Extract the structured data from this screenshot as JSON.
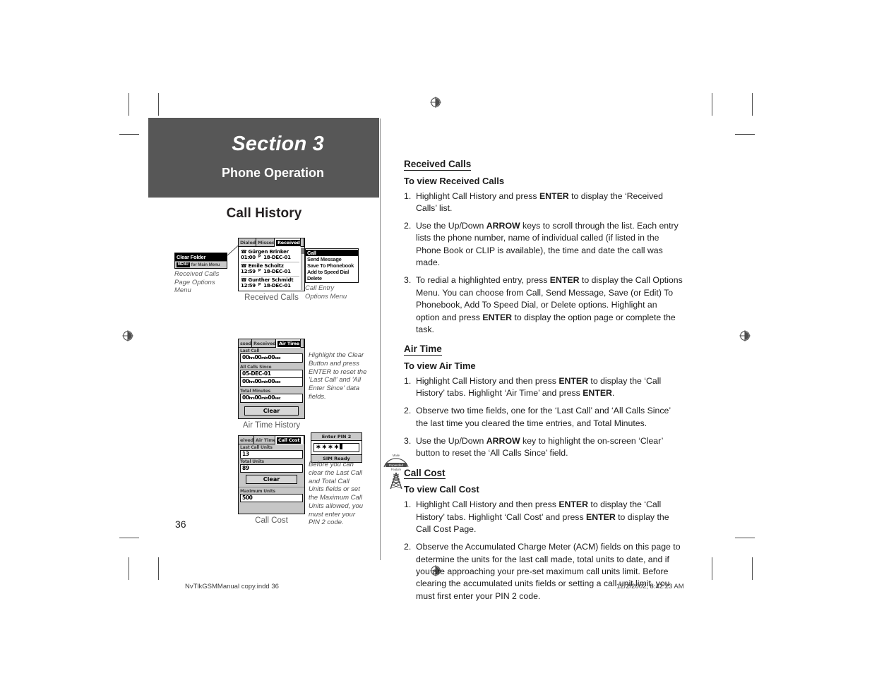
{
  "header": {
    "section": "Section 3",
    "subtitle": "Phone Operation"
  },
  "left_column": {
    "heading": "Call History",
    "received_calls_figure": {
      "caption": "Received Calls",
      "tabs": [
        {
          "label": "Dialed",
          "active": false
        },
        {
          "label": "Missed",
          "active": false
        },
        {
          "label": "Received",
          "active": true
        }
      ],
      "entries": [
        {
          "icon": "phone-icon",
          "name": "Gürgen Brinker",
          "time": "01:00",
          "ampm": "P",
          "date": "18-DEC-01"
        },
        {
          "icon": "phone-icon",
          "name": "Emile Scholtz",
          "time": "12:59",
          "ampm": "P",
          "date": "18-DEC-01"
        },
        {
          "icon": "phone-icon",
          "name": "Gunther Schmidt",
          "time": "12:59",
          "ampm": "P",
          "date": "18-DEC-01"
        }
      ]
    },
    "options_menu": {
      "selected_item": "Clear Folder",
      "footer_key": "MENU",
      "footer_text": "for Main Menu",
      "note": "Received Calls Page Options Menu"
    },
    "call_entry_menu": {
      "items": [
        {
          "label": "Call",
          "selected": true
        },
        {
          "label": "Send Message",
          "selected": false
        },
        {
          "label": "Save To Phonebook",
          "selected": false
        },
        {
          "label": "Add to Speed Dial",
          "selected": false
        },
        {
          "label": "Delete",
          "selected": false
        }
      ],
      "note": "Call Entry Options Menu"
    },
    "air_time_figure": {
      "caption": "Air Time History",
      "tabs": [
        {
          "label": "ssed",
          "active": false
        },
        {
          "label": "Received",
          "active": false
        },
        {
          "label": "Air Time",
          "active": true
        }
      ],
      "fields": [
        {
          "label": "Last Call",
          "value": "00hrs00min00sec"
        },
        {
          "label": "All Calls Since",
          "value_date": "05-DEC-01",
          "value": "00hrs00min00sec"
        },
        {
          "label": "Total Minutes",
          "value": "00hrs00min00sec"
        }
      ],
      "button": "Clear",
      "note": "Highlight the Clear Button and press ENTER to reset the 'Last Call' and 'All Enter Since' data fields."
    },
    "call_cost_figure": {
      "caption": "Call Cost",
      "tabs": [
        {
          "label": "eived",
          "active": false
        },
        {
          "label": "Air Time",
          "active": false
        },
        {
          "label": "Call Cost",
          "active": true
        }
      ],
      "fields": [
        {
          "label": "Last Call Units",
          "value": "13"
        },
        {
          "label": "Total Units",
          "value": "89"
        },
        {
          "label": "Maximum Units",
          "value": "500"
        }
      ],
      "button": "Clear",
      "pin_dialog": {
        "title": "Enter PIN 2",
        "value": "∗∗∗∗",
        "status": "SIM Ready"
      },
      "note": "Before you can clear the Last Call and Total Call Units fields or set the Maximum Call Units allowed, you must enter your PIN 2 code."
    }
  },
  "right_column": {
    "blocks": [
      {
        "heading": "Received Calls",
        "subheading": "To view Received Calls",
        "steps": [
          {
            "num": "1.",
            "html": "Highlight Call History and press <b>ENTER</b> to display the ‘Received Calls’ list."
          },
          {
            "num": "2.",
            "html": "Use the Up/Down <b>ARROW</b> keys to scroll through the list. Each entry lists the phone number, name of individual called (if listed in the Phone Book or CLIP is available), the time and date the call was made."
          },
          {
            "num": "3.",
            "html": "To redial a highlighted entry, press <b>ENTER</b> to display the Call Options Menu. You can choose from Call, Send Message, Save (or Edit) To Phonebook, Add To Speed Dial, or Delete options. Highlight an option and press <b>ENTER</b> to display the option page or complete the task."
          }
        ]
      },
      {
        "heading": "Air Time",
        "subheading": "To view Air Time",
        "steps": [
          {
            "num": "1.",
            "html": "Highlight Call History and then press <b>ENTER</b> to display the ‘Call History’ tabs. Highlight ‘Air Time’ and press <b>ENTER</b>."
          },
          {
            "num": "2.",
            "html": "Observe two time fields, one for the ‘Last Call’ and ‘All Calls Since’ the last time you cleared the time entries, and Total Minutes."
          },
          {
            "num": "3.",
            "html": "Use the Up/Down <b>ARROW</b> key to highlight the on-screen ‘Clear’ button to reset the ‘All Calls Since’ field."
          }
        ]
      },
      {
        "heading": "Call Cost",
        "subheading": "To view Call Cost",
        "steps": [
          {
            "num": "1.",
            "html": "Highlight Call History and then press <b>ENTER</b> to display the ‘Call History’ tabs.  Highlight ‘Call Cost’ and press <b>ENTER</b> to display the Call Cost Page."
          },
          {
            "num": "2.",
            "html": "Observe the Accumulated Charge Meter (ACM) fields on this page to determine the units for the last call made, total units to date, and if you are approaching your pre-set maximum call units limit. Before clearing the accumulated units fields or setting a call unit limit, you must first enter your PIN 2 code."
          }
        ]
      }
    ]
  },
  "page_number": "36",
  "footer": {
    "file": "NvTlkGSMManual copy.indd   36",
    "date": "12/2/2002, 8:42:23 AM"
  },
  "colors": {
    "header_band": "#575757",
    "text": "#1b1b1b",
    "caption": "#5d5d5d"
  }
}
